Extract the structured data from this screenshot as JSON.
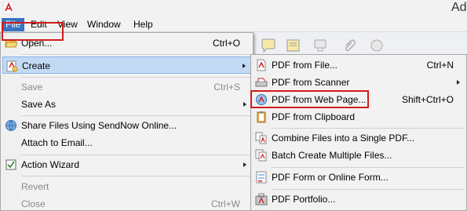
{
  "window": {
    "title_fragment": "Ad"
  },
  "menubar": {
    "items": [
      {
        "label": "File",
        "active": true
      },
      {
        "label": "Edit"
      },
      {
        "label": "View"
      },
      {
        "label": "Window"
      },
      {
        "label": "Help"
      }
    ]
  },
  "toolbar": {
    "icons": [
      "speech-bubble-icon",
      "sticky-note-icon",
      "stamp-icon",
      "attach-icon",
      "highlight-icon",
      "audio-icon",
      "signature-icon"
    ]
  },
  "file_menu": {
    "open": {
      "label": "Open...",
      "accel": "Ctrl+O",
      "icon": "folder-open-icon"
    },
    "create": {
      "label": "Create",
      "icon": "create-pdf-icon",
      "has_submenu": true,
      "highlighted": true
    },
    "save": {
      "label": "Save",
      "accel": "Ctrl+S",
      "disabled": true
    },
    "save_as": {
      "label": "Save As",
      "has_submenu": true
    },
    "share": {
      "label": "Share Files Using SendNow Online...",
      "icon": "share-globe-icon"
    },
    "attach_email": {
      "label": "Attach to Email..."
    },
    "action_wizard": {
      "label": "Action Wizard",
      "icon": "action-wizard-icon",
      "has_submenu": true
    },
    "revert": {
      "label": "Revert",
      "disabled": true
    },
    "close": {
      "label": "Close",
      "accel": "Ctrl+W",
      "disabled": true
    }
  },
  "create_submenu": {
    "from_file": {
      "label": "PDF from File...",
      "accel": "Ctrl+N",
      "icon": "pdf-file-icon"
    },
    "from_scanner": {
      "label": "PDF from Scanner",
      "icon": "scanner-icon",
      "has_submenu": true
    },
    "from_web_page": {
      "label": "PDF from Web Page...",
      "accel": "Shift+Ctrl+O",
      "icon": "web-page-icon"
    },
    "from_clipboard": {
      "label": "PDF from Clipboard",
      "icon": "clipboard-icon"
    },
    "combine": {
      "label": "Combine Files into a Single PDF...",
      "icon": "combine-files-icon"
    },
    "batch": {
      "label": "Batch Create Multiple Files...",
      "icon": "batch-create-icon"
    },
    "form": {
      "label": "PDF Form or Online Form...",
      "icon": "form-icon"
    },
    "portfolio": {
      "label": "PDF Portfolio...",
      "icon": "portfolio-icon"
    }
  },
  "colors": {
    "menubar_active": "#3a72c3",
    "highlight_box": "#d11c1c",
    "hover_fill": "#c3daf5"
  }
}
